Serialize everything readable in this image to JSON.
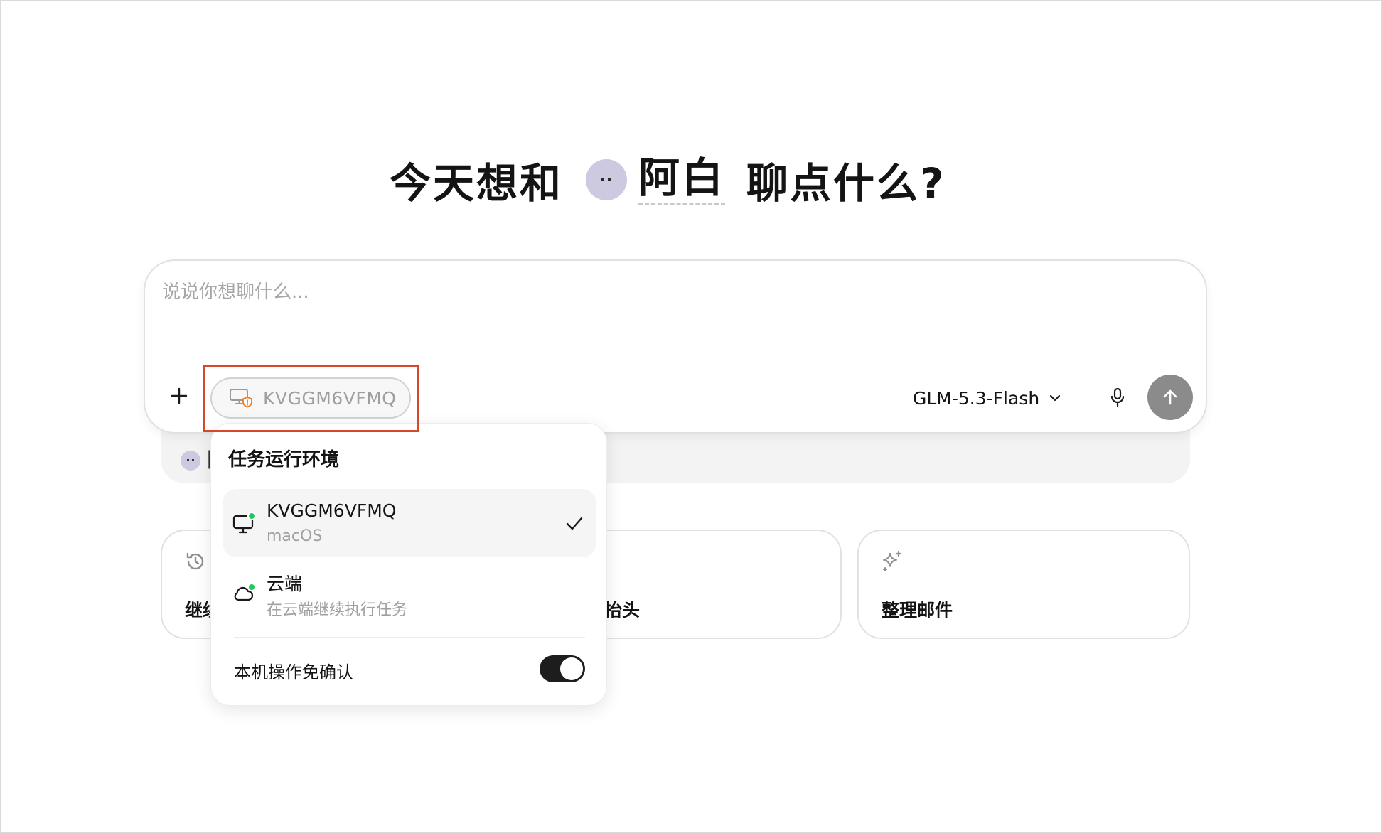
{
  "headline": {
    "prefix": "今天想和",
    "agent_name": "阿白",
    "suffix": "聊点什么?"
  },
  "composer": {
    "placeholder": "说说你想聊什么...",
    "value": "",
    "environment_pill_label": "KVGGM6VFMQ",
    "model_label": "GLM-5.3-Flash"
  },
  "environment_menu": {
    "title": "任务运行环境",
    "options": [
      {
        "name": "KVGGM6VFMQ",
        "subtitle": "macOS",
        "icon": "monitor-icon",
        "status_color": "#22c55e",
        "selected": true
      },
      {
        "name": "云端",
        "subtitle": "在云端继续执行任务",
        "icon": "cloud-icon",
        "status_color": "#22c55e",
        "selected": false
      }
    ],
    "toggle_label": "本机操作免确认",
    "toggle_on": true
  },
  "suggestions": [
    {
      "label": "继续",
      "icon": "history-icon"
    },
    {
      "label": "抬头",
      "icon": ""
    },
    {
      "label": "整理邮件",
      "icon": "sparkle-icon"
    }
  ],
  "colors": {
    "highlight": "#d9472b",
    "warning": "#f07a1a",
    "send_button": "#8b8b8b",
    "avatar": "#cdc9e0"
  }
}
